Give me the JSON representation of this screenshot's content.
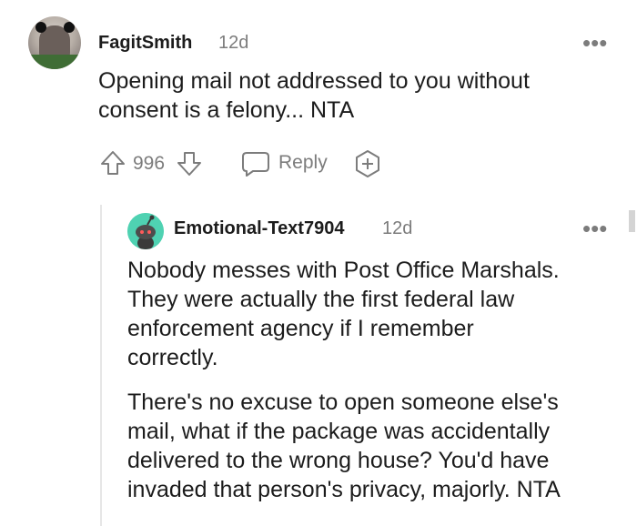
{
  "comment": {
    "username": "FagitSmith",
    "time": "12d",
    "more": "•••",
    "body": [
      "Opening mail not addressed to you without",
      "consent is a felony... NTA"
    ],
    "votes": "996",
    "reply_label": "Reply"
  },
  "reply": {
    "username": "Emotional-Text7904",
    "time": "12d",
    "more": "•••",
    "para1": [
      "Nobody messes with Post Office Marshals.",
      "They were actually the first federal law",
      "enforcement agency if I remember",
      "correctly."
    ],
    "para2": [
      "There's no excuse to open someone else's",
      "mail, what if the package was accidentally",
      "delivered to the wrong house? You'd have",
      "invaded that person's privacy, majorly. NTA"
    ]
  },
  "icons": {
    "upvote": "arrow-up-outline-icon",
    "downvote": "arrow-down-outline-icon",
    "reply": "speech-bubble-icon",
    "award": "award-plus-icon",
    "more": "more-dots-icon"
  },
  "colors": {
    "text": "#1c1c1c",
    "muted": "#7c7c7c",
    "avatar2": "#4fd2b2"
  }
}
